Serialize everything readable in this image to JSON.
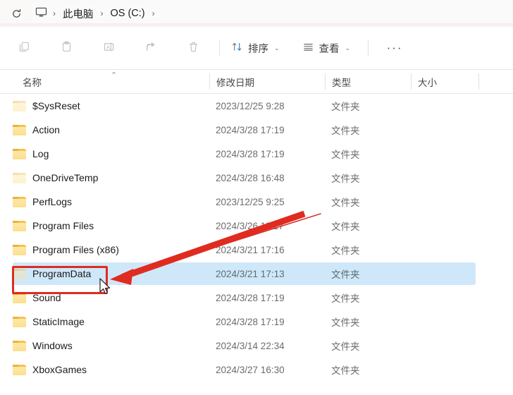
{
  "titlebar": {
    "refresh_icon": "refresh-icon"
  },
  "address_bar": {
    "pc_icon": "this-pc-icon",
    "separator": "›",
    "crumbs": [
      {
        "label": "此电脑"
      },
      {
        "label": "OS (C:)"
      }
    ]
  },
  "toolbar": {
    "items": [
      {
        "name": "copy",
        "icon": "copy-icon",
        "label": ""
      },
      {
        "name": "paste",
        "icon": "paste-icon",
        "label": ""
      },
      {
        "name": "rename",
        "icon": "rename-icon",
        "label": ""
      },
      {
        "name": "share",
        "icon": "share-icon",
        "label": ""
      },
      {
        "name": "delete",
        "icon": "trash-icon",
        "label": ""
      }
    ],
    "sort_label": "排序",
    "view_label": "查看",
    "more_label": "···",
    "caret": "⌄"
  },
  "columns": {
    "name": "名称",
    "date": "修改日期",
    "type": "类型",
    "size": "大小",
    "sort_indicator": "⌃"
  },
  "rows": [
    {
      "name": "$SysReset",
      "date": "2023/12/25 9:28",
      "type": "文件夹",
      "size": "",
      "hidden": true,
      "selected": false
    },
    {
      "name": "Action",
      "date": "2024/3/28 17:19",
      "type": "文件夹",
      "size": "",
      "hidden": false,
      "selected": false
    },
    {
      "name": "Log",
      "date": "2024/3/28 17:19",
      "type": "文件夹",
      "size": "",
      "hidden": false,
      "selected": false
    },
    {
      "name": "OneDriveTemp",
      "date": "2024/3/28 16:48",
      "type": "文件夹",
      "size": "",
      "hidden": true,
      "selected": false
    },
    {
      "name": "PerfLogs",
      "date": "2023/12/25 9:25",
      "type": "文件夹",
      "size": "",
      "hidden": false,
      "selected": false
    },
    {
      "name": "Program Files",
      "date": "2024/3/26 11:27",
      "type": "文件夹",
      "size": "",
      "hidden": false,
      "selected": false
    },
    {
      "name": "Program Files (x86)",
      "date": "2024/3/21 17:16",
      "type": "文件夹",
      "size": "",
      "hidden": false,
      "selected": false
    },
    {
      "name": "ProgramData",
      "date": "2024/3/21 17:13",
      "type": "文件夹",
      "size": "",
      "hidden": true,
      "selected": true
    },
    {
      "name": "Sound",
      "date": "2024/3/28 17:19",
      "type": "文件夹",
      "size": "",
      "hidden": false,
      "selected": false
    },
    {
      "name": "StaticImage",
      "date": "2024/3/28 17:19",
      "type": "文件夹",
      "size": "",
      "hidden": false,
      "selected": false
    },
    {
      "name": "Windows",
      "date": "2024/3/14 22:34",
      "type": "文件夹",
      "size": "",
      "hidden": false,
      "selected": false
    },
    {
      "name": "XboxGames",
      "date": "2024/3/27 16:30",
      "type": "文件夹",
      "size": "",
      "hidden": false,
      "selected": false
    }
  ],
  "annotations": {
    "highlight_color": "#e02b20",
    "highlight_target": "ProgramData",
    "arrow": "red-arrow",
    "cursor": "mouse-pointer"
  },
  "colors": {
    "selection": "#cfe8f9",
    "folder": "#f3c34a",
    "accent_red": "#e02b20"
  }
}
